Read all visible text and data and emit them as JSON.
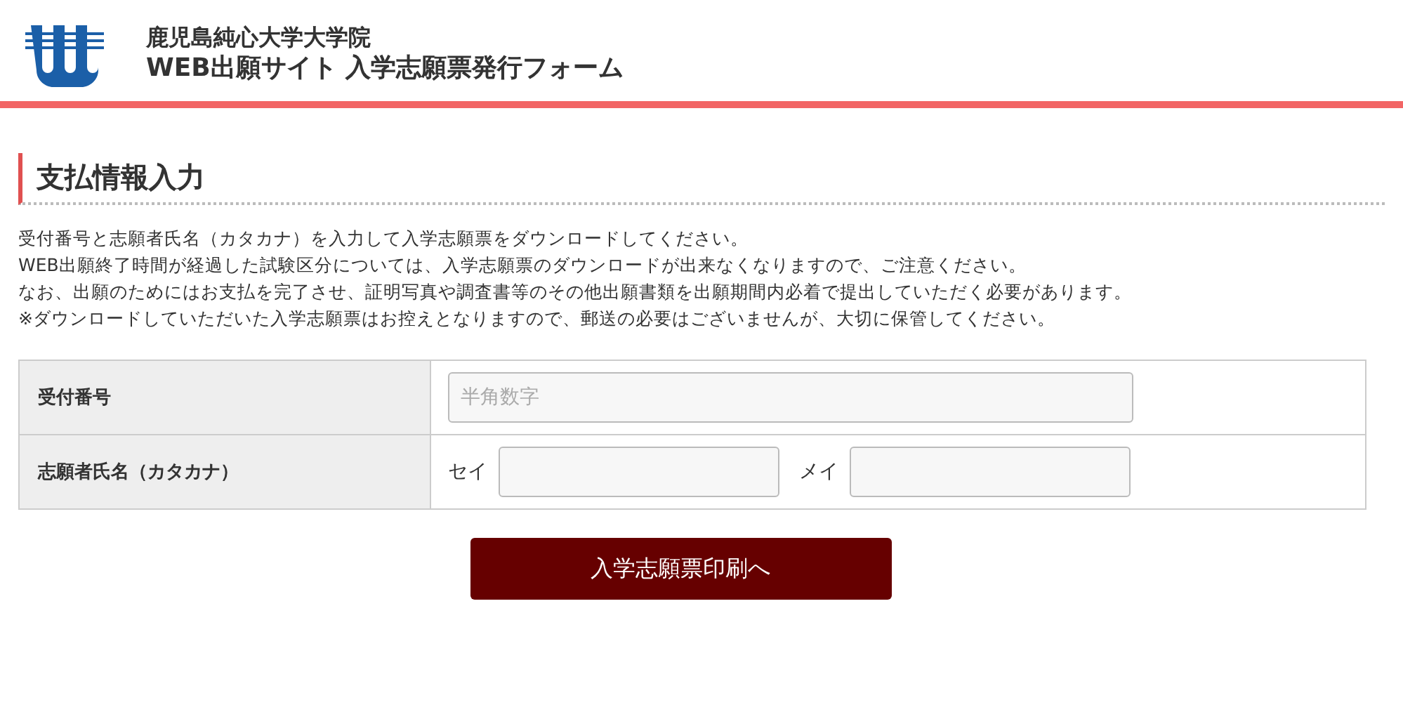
{
  "header": {
    "title_line_1": "鹿児島純心大学大学院",
    "title_line_2": "WEB出願サイト 入学志願票発行フォーム"
  },
  "section": {
    "heading": "支払情報入力"
  },
  "notes": [
    "受付番号と志願者氏名（カタカナ）を入力して入学志願票をダウンロードしてください。",
    "WEB出願終了時間が経過した試験区分については、入学志願票のダウンロードが出来なくなりますので、ご注意ください。",
    "なお、出願のためにはお支払を完了させ、証明写真や調査書等のその他出願書類を出願期間内必着で提出していただく必要があります。",
    "※ダウンロードしていただいた入学志願票はお控えとなりますので、郵送の必要はございませんが、大切に保管してください。"
  ],
  "form": {
    "rows": [
      {
        "label": "受付番号",
        "kind": "single",
        "fields": [
          {
            "placeholder": "半角数字"
          }
        ]
      },
      {
        "label": "志願者氏名（カタカナ）",
        "kind": "pair",
        "fields": [
          {
            "prefix": "セイ"
          },
          {
            "prefix": "メイ"
          }
        ]
      }
    ]
  },
  "submit_button": "入学志願票印刷へ"
}
